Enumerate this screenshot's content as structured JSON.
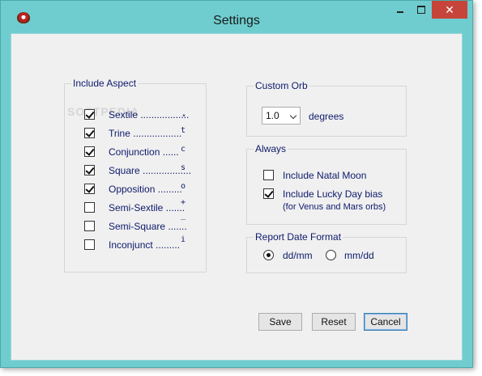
{
  "window": {
    "title": "Settings"
  },
  "aspects": {
    "legend": "Include Aspect",
    "items": [
      {
        "label": "Sextile ..................",
        "symbol": "⋆",
        "checked": true
      },
      {
        "label": "Trine ..................",
        "symbol": "t",
        "checked": true
      },
      {
        "label": "Conjunction ......",
        "symbol": "c",
        "checked": true
      },
      {
        "label": "Square ..................",
        "symbol": "s",
        "checked": true
      },
      {
        "label": "Opposition .........",
        "symbol": "o",
        "checked": true
      },
      {
        "label": "Semi-Sextile .......",
        "symbol": "+",
        "checked": false
      },
      {
        "label": "Semi-Square .......",
        "symbol": "‾",
        "checked": false
      },
      {
        "label": "Inconjunct .........",
        "symbol": "i",
        "checked": false
      }
    ]
  },
  "custom_orb": {
    "legend": "Custom Orb",
    "value": "1.0",
    "unit": "degrees"
  },
  "always": {
    "legend": "Always",
    "natal_moon": {
      "label": "Include Natal Moon",
      "checked": false
    },
    "lucky_day": {
      "label": "Include Lucky Day bias",
      "sublabel": "(for Venus and Mars orbs)",
      "checked": true
    }
  },
  "report_date": {
    "legend": "Report Date Format",
    "options": [
      {
        "label": "dd/mm",
        "selected": true
      },
      {
        "label": "mm/dd",
        "selected": false
      }
    ]
  },
  "buttons": {
    "save": "Save",
    "reset": "Reset",
    "cancel": "Cancel"
  }
}
